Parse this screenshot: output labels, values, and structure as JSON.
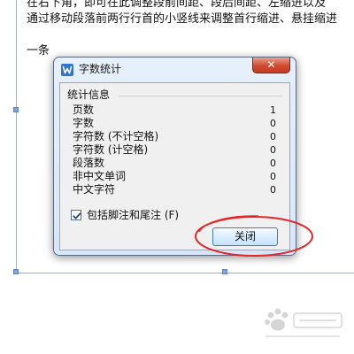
{
  "document": {
    "line1": "在右下角，即可在此调整段前间距、段后间距、左缩进以及",
    "line2": "通过移动段落前两行行首的小竖线来调整首行缩进、悬挂缩进",
    "line3": "一条"
  },
  "dialog": {
    "title": "字数统计",
    "close_glyph": "✕",
    "group_title": "统计信息",
    "stats": [
      {
        "label": "页数",
        "value": "1"
      },
      {
        "label": "字数",
        "value": "0"
      },
      {
        "label": "字符数 (不计空格)",
        "value": "0"
      },
      {
        "label": "字符数 (计空格)",
        "value": "0"
      },
      {
        "label": "段落数",
        "value": "0"
      },
      {
        "label": "非中文单词",
        "value": "0"
      },
      {
        "label": "中文字符",
        "value": "0"
      }
    ],
    "checkbox_label": "包括脚注和尾注 (F)",
    "checkbox_checked": true,
    "close_button_label": "关闭"
  },
  "annotation": {
    "color": "#e3262b"
  },
  "watermark": {
    "description_icon": "baidu-jingyan-paw-logo"
  },
  "colors": {
    "app_icon": "#2f76d2",
    "close_button": "#d04a2f",
    "dialog_background": "#d7e6f7"
  }
}
